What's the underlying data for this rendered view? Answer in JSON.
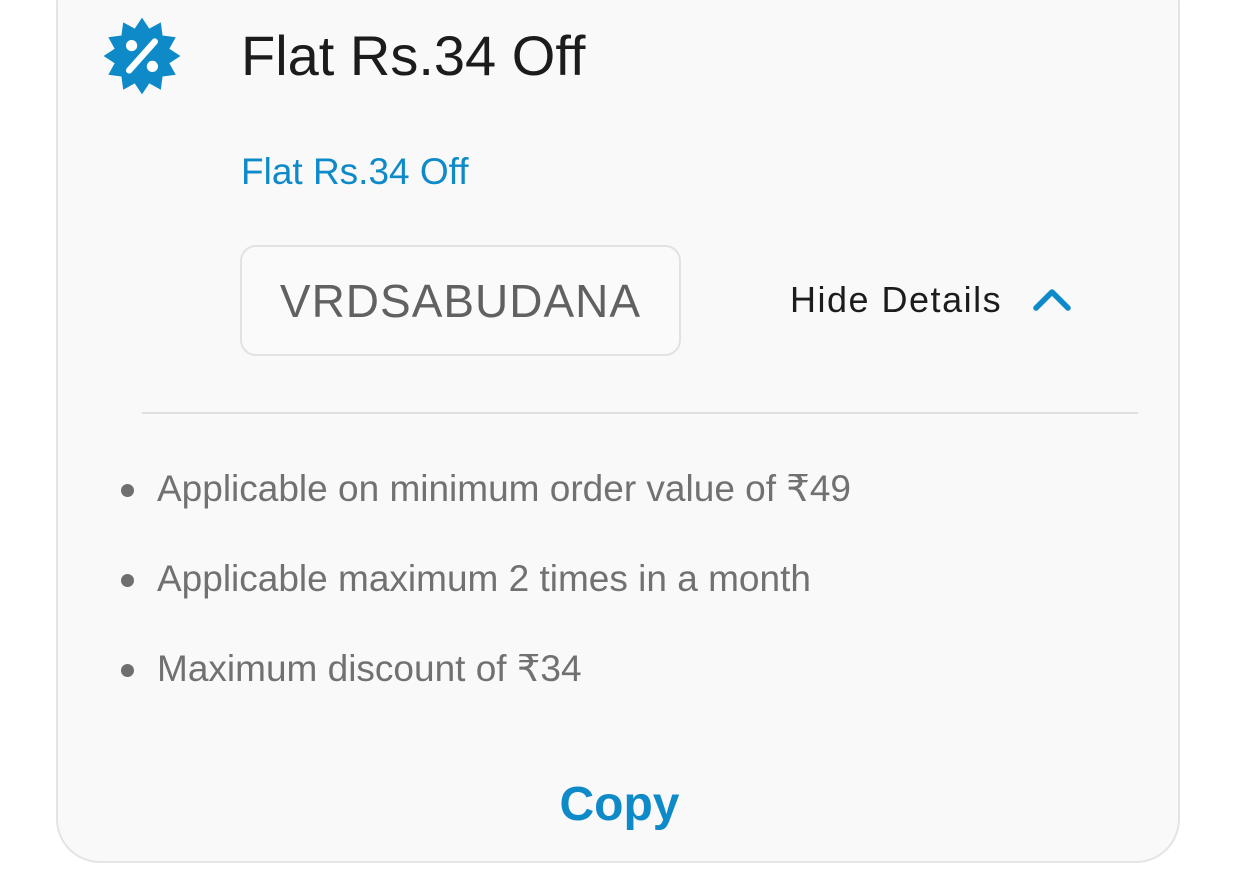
{
  "offer": {
    "title": "Flat Rs.34 Off",
    "subtitle": "Flat Rs.34 Off",
    "coupon_code": "VRDSABUDANA",
    "toggle_label": "Hide Details",
    "toggle_icon": "chevron-up-icon",
    "badge_icon": "discount-percent-badge-icon",
    "terms": [
      "Applicable on minimum order value of ₹49",
      "Applicable maximum 2 times in a month",
      "Maximum discount of ₹34"
    ],
    "copy_label": "Copy"
  },
  "colors": {
    "accent": "#0E8AC8",
    "title_text": "#1C1C1C",
    "muted_text": "#717171",
    "card_background": "#F9F9F9",
    "border": "#E4E4E4"
  }
}
